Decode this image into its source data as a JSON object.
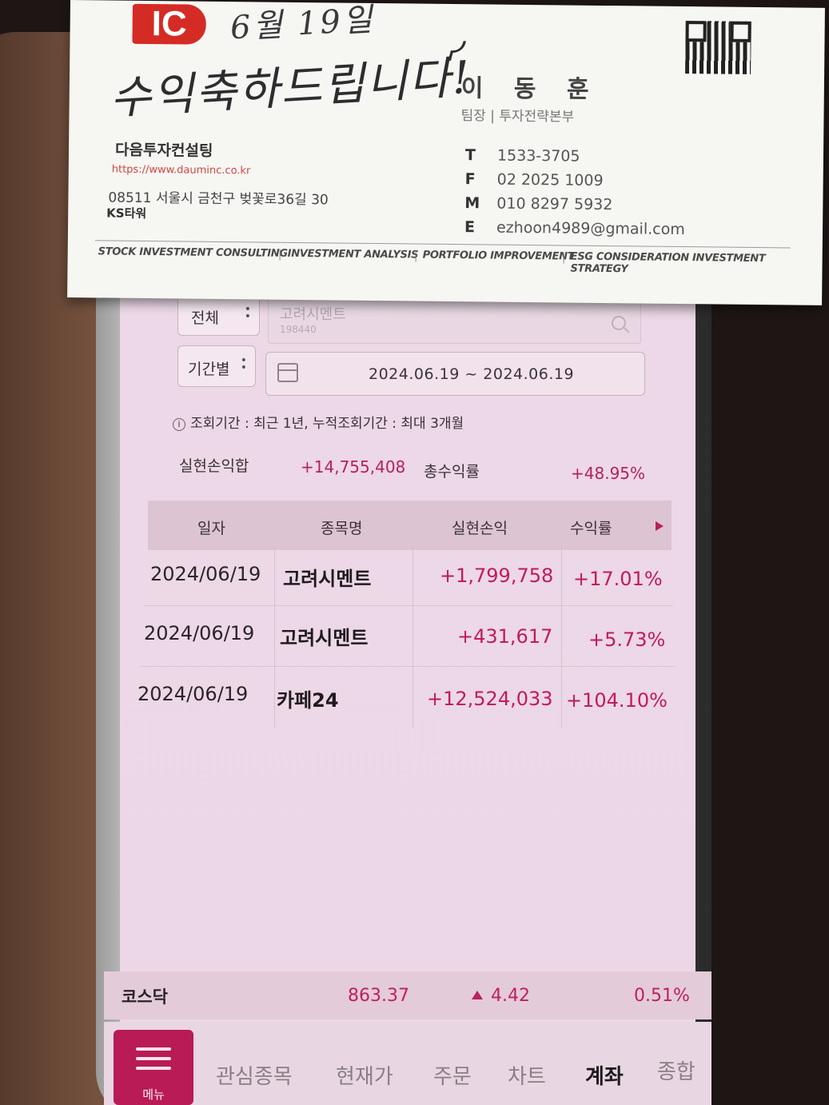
{
  "app": {
    "filter": {
      "scope_select": "전체",
      "period_select": "기간별",
      "stock_search": {
        "name": "고려시멘트",
        "code": "198440"
      },
      "date_range": "2024.06.19 ~ 2024.06.19",
      "notice": "조회기간 : 최근 1년, 누적조회기간 : 최대 3개월"
    },
    "summary": {
      "realized_label": "실현손익합",
      "realized_value": "+14,755,408",
      "return_label": "총수익률",
      "return_value": "+48.95%"
    },
    "table": {
      "headers": [
        "일자",
        "종목명",
        "실현손익",
        "수익률"
      ],
      "rows": [
        {
          "date": "2024/06/19",
          "name": "고려시멘트",
          "pl": "+1,799,758",
          "rate": "+17.01%"
        },
        {
          "date": "2024/06/19",
          "name": "고려시멘트",
          "pl": "+431,617",
          "rate": "+5.73%"
        },
        {
          "date": "2024/06/19",
          "name": "카페24",
          "pl": "+12,524,033",
          "rate": "+104.10%"
        }
      ]
    },
    "index_ticker": {
      "name": "코스닥",
      "value": "863.37",
      "change": "4.42",
      "change_pct": "0.51%"
    },
    "bottom_nav": {
      "menu_label": "메뉴",
      "items": [
        "관심종목",
        "현재가",
        "주문",
        "차트",
        "계좌",
        "종합"
      ],
      "active": "계좌"
    }
  },
  "business_card": {
    "logo_text": "IC",
    "handwritten_date": "6월 19일",
    "handwritten_message": "수익축하드립니다!",
    "name": "이 동 훈",
    "title": "팀장 | 투자전략본부",
    "company": "다음투자컨설팅",
    "website": "https://www.dauminc.co.kr",
    "address": "08511 서울시 금천구 벚꽃로36길 30",
    "building": "KS타워",
    "contacts": [
      {
        "key": "T",
        "value": "1533-3705"
      },
      {
        "key": "F",
        "value": "02 2025 1009"
      },
      {
        "key": "M",
        "value": "010 8297 5932"
      },
      {
        "key": "E",
        "value": "ezhoon4989@gmail.com"
      }
    ],
    "services": [
      "STOCK INVESTMENT CONSULTING",
      "INVESTMENT ANALYSIS",
      "PORTFOLIO IMPROVEMENT",
      "ESG CONSIDERATION INVESTMENT STRATEGY"
    ]
  },
  "colors": {
    "accent": "#b81b56",
    "profit": "#c11a5d",
    "screen_bg": "#ecd8e6",
    "logo_red": "#d52b25"
  }
}
